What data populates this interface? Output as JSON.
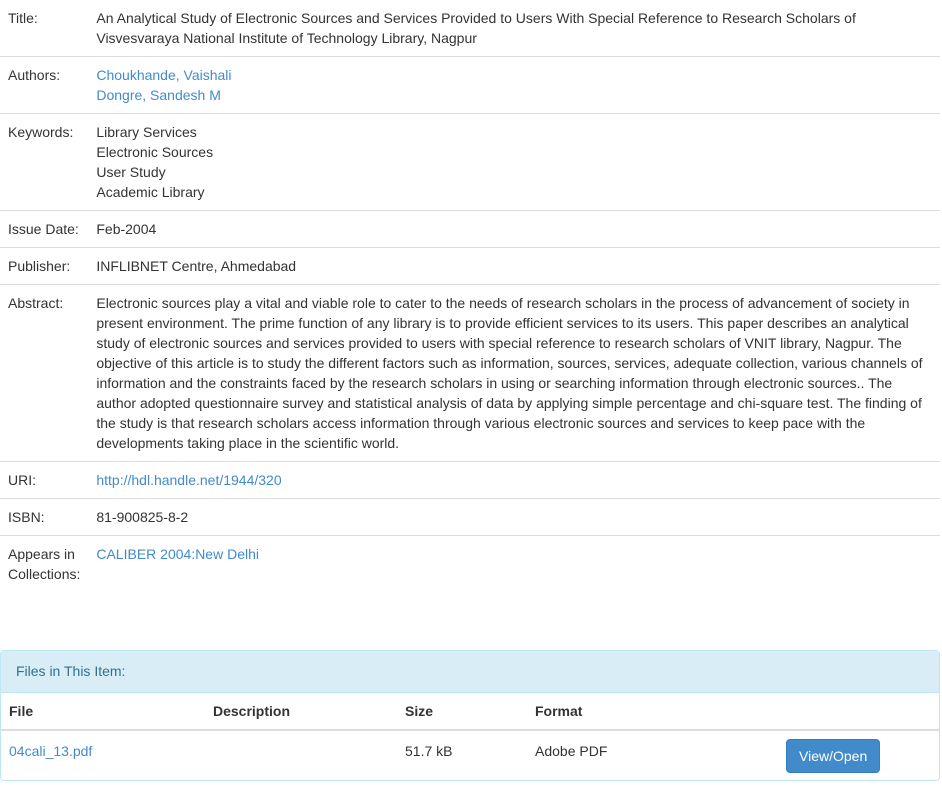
{
  "item": {
    "title_label": "Title:",
    "title": "An Analytical Study of Electronic Sources and Services Provided to Users With Special Reference to Research Scholars of Visvesvaraya National Institute of Technology Library, Nagpur",
    "authors_label": "Authors:",
    "authors": [
      "Choukhande, Vaishali",
      "Dongre, Sandesh M"
    ],
    "keywords_label": "Keywords:",
    "keywords": [
      "Library Services",
      "Electronic Sources",
      "User Study",
      "Academic Library"
    ],
    "issue_date_label": "Issue Date:",
    "issue_date": "Feb-2004",
    "publisher_label": "Publisher:",
    "publisher": "INFLIBNET Centre, Ahmedabad",
    "abstract_label": "Abstract:",
    "abstract": "Electronic sources play a vital and viable role to cater to the needs of research scholars in the process of advancement of society in present environment. The prime function of any library is to provide efficient services to its users. This paper describes an analytical study of electronic sources and services provided to users with special reference to research scholars of VNIT library, Nagpur. The objective of this article is to study the different factors such as information, sources, services, adequate collection, various channels of information and the constraints faced by the research scholars in using or searching information through electronic sources.. The author adopted questionnaire survey and statistical analysis of data by applying simple percentage and chi-square test. The finding of the study is that research scholars access information through various electronic sources and services to keep pace with the developments taking place in the scientific world.",
    "uri_label": "URI:",
    "uri": "http://hdl.handle.net/1944/320",
    "isbn_label": "ISBN:",
    "isbn": "81-900825-8-2",
    "collections_label": "Appears in Collections:",
    "collection": "CALIBER 2004:New Delhi"
  },
  "files_panel": {
    "heading": "Files in This Item:",
    "columns": [
      "File",
      "Description",
      "Size",
      "Format"
    ],
    "rows": [
      {
        "file": "04cali_13.pdf",
        "description": "",
        "size": "51.7 kB",
        "format": "Adobe PDF",
        "action": "View/Open"
      }
    ]
  },
  "colors": {
    "link": "#428bca",
    "button": "#428bca",
    "panel_heading_bg": "#d9edf7",
    "panel_heading_text": "#31708f"
  }
}
